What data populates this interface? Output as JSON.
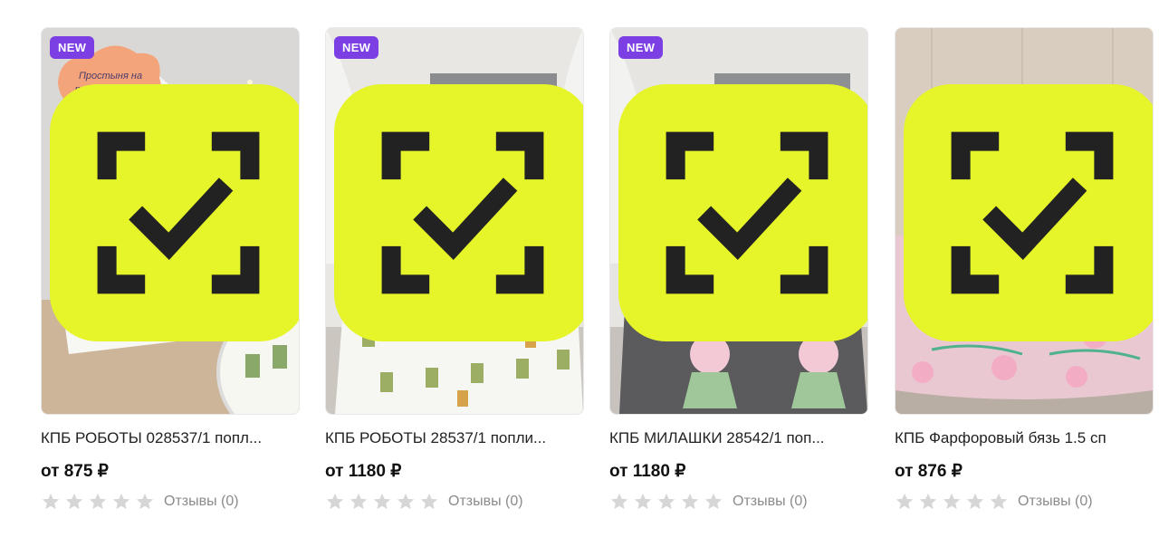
{
  "products": [
    {
      "badge": "NEW",
      "image_label": "Простыня на резинке 80*160",
      "title": "КПБ РОБОТЫ 028537/1 попл...",
      "price": "от 875 ₽",
      "rating": 0,
      "reviews": "Отзывы (0)",
      "quick_view_icon": "quick-view-icon"
    },
    {
      "badge": "NEW",
      "title": "КПБ РОБОТЫ 28537/1 попли...",
      "price": "от 1180 ₽",
      "rating": 0,
      "reviews": "Отзывы (0)",
      "quick_view_icon": "quick-view-icon"
    },
    {
      "badge": "NEW",
      "title": "КПБ МИЛАШКИ 28542/1 поп...",
      "price": "от 1180 ₽",
      "rating": 0,
      "reviews": "Отзывы (0)",
      "quick_view_icon": "quick-view-icon"
    },
    {
      "title": "КПБ Фарфоровый бязь 1.5 сп",
      "price": "от 876 ₽",
      "rating": 0,
      "reviews": "Отзывы (0)",
      "quick_view_icon": "quick-view-icon"
    }
  ],
  "colors": {
    "badge_bg": "#7b3fe4",
    "quick_view_bg": "#e6f52a",
    "star_empty": "#d6d6d6",
    "review_text": "#8b8b8b"
  }
}
